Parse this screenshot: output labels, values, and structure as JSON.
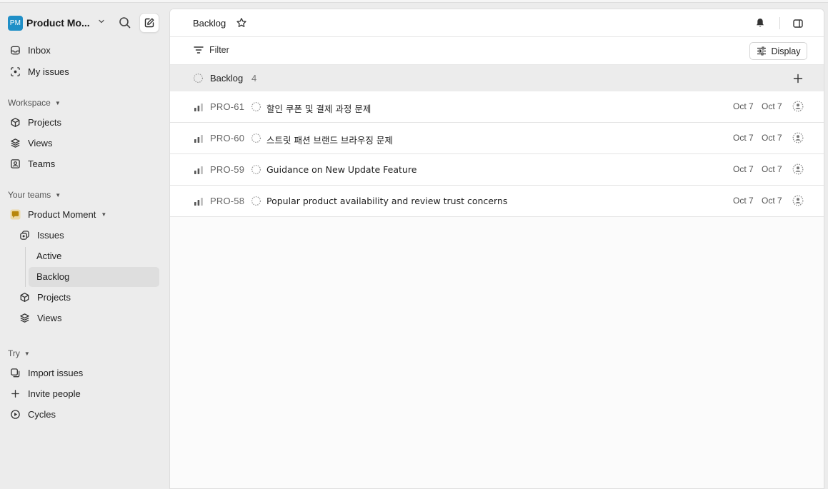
{
  "workspace": {
    "initials": "PM",
    "name": "Product Mo..."
  },
  "sidebar": {
    "top_items": [
      {
        "label": "Inbox",
        "icon": "inbox-icon"
      },
      {
        "label": "My issues",
        "icon": "my-issues-icon"
      }
    ],
    "workspace_section": {
      "label": "Workspace",
      "items": [
        {
          "label": "Projects",
          "icon": "cube-icon"
        },
        {
          "label": "Views",
          "icon": "layers-icon"
        },
        {
          "label": "Teams",
          "icon": "teams-icon"
        }
      ]
    },
    "teams_section": {
      "label": "Your teams",
      "team": {
        "name": "Product Moment",
        "color": "#b8860b"
      },
      "items": [
        {
          "label": "Issues",
          "icon": "issues-icon"
        },
        {
          "label": "Active"
        },
        {
          "label": "Backlog"
        },
        {
          "label": "Projects",
          "icon": "cube-icon"
        },
        {
          "label": "Views",
          "icon": "layers-icon"
        }
      ]
    },
    "try_section": {
      "label": "Try",
      "items": [
        {
          "label": "Import issues",
          "icon": "import-icon"
        },
        {
          "label": "Invite people",
          "icon": "plus-icon"
        },
        {
          "label": "Cycles",
          "icon": "cycles-icon"
        }
      ]
    }
  },
  "header": {
    "title": "Backlog"
  },
  "toolbar": {
    "filter_label": "Filter",
    "display_label": "Display"
  },
  "group": {
    "name": "Backlog",
    "count": "4"
  },
  "issues": [
    {
      "id": "PRO-61",
      "title": "할인 쿠폰 및 결제 과정 문제",
      "created": "Oct 7",
      "updated": "Oct 7"
    },
    {
      "id": "PRO-60",
      "title": "스트릿 패션 브랜드 브라우징 문제",
      "created": "Oct 7",
      "updated": "Oct 7"
    },
    {
      "id": "PRO-59",
      "title": "Guidance on New Update Feature",
      "created": "Oct 7",
      "updated": "Oct 7"
    },
    {
      "id": "PRO-58",
      "title": "Popular product availability and review trust concerns",
      "created": "Oct 7",
      "updated": "Oct 7"
    }
  ],
  "colors": {
    "workspace_badge": "#1f8fc7",
    "active_nav_bg": "#dedede"
  }
}
